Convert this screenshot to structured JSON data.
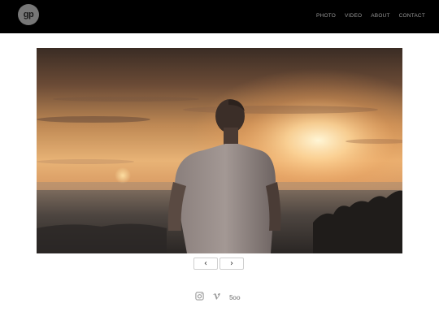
{
  "header": {
    "logo_text": "gp",
    "nav": [
      {
        "label": "PHOTO"
      },
      {
        "label": "VIDEO"
      },
      {
        "label": "ABOUT"
      },
      {
        "label": "CONTACT"
      }
    ]
  },
  "gallery": {
    "prev_label": "‹",
    "next_label": "›",
    "image_subject": "silhouette of man facing sunset over hills and city"
  },
  "social": {
    "icons": [
      "instagram-icon",
      "vimeo-icon",
      "500px-icon"
    ],
    "fivehundred_label": "5oo"
  },
  "colors": {
    "topbar": "#000000",
    "nav_text": "#9a9a9a",
    "logo_bg": "#777777",
    "page_bg": "#ffffff"
  }
}
